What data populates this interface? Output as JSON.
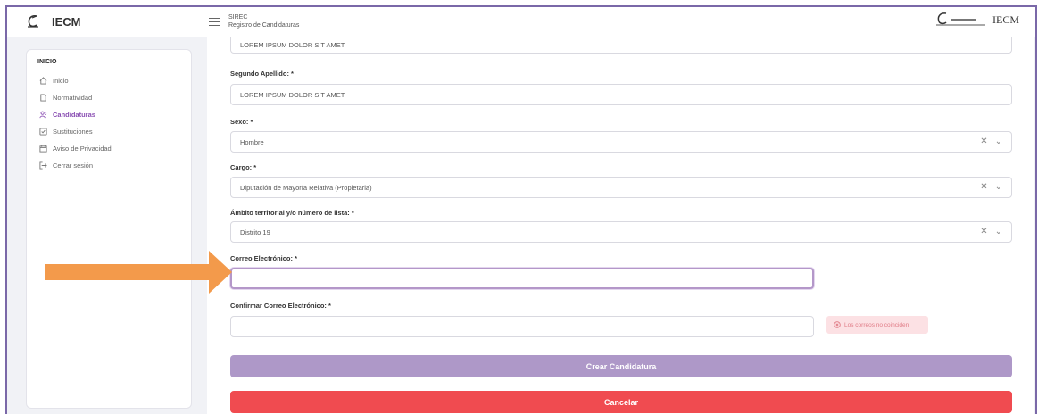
{
  "header": {
    "brand": "IECM",
    "app_name": "SIREC",
    "app_subtitle": "Registro de Candidaturas",
    "right_brand": "IECM"
  },
  "sidebar": {
    "heading": "INICIO",
    "items": [
      {
        "label": "Inicio",
        "icon": "home-icon",
        "active": false
      },
      {
        "label": "Normatividad",
        "icon": "document-icon",
        "active": false
      },
      {
        "label": "Candidaturas",
        "icon": "users-icon",
        "active": true
      },
      {
        "label": "Sustituciones",
        "icon": "check-square-icon",
        "active": false
      },
      {
        "label": "Aviso de Privacidad",
        "icon": "calendar-icon",
        "active": false
      },
      {
        "label": "Cerrar sesión",
        "icon": "logout-icon",
        "active": false
      }
    ]
  },
  "form": {
    "previous_value": "LOREM IPSUM DOLOR SIT AMET",
    "segundo_apellido": {
      "label": "Segundo Apellido: *",
      "value": "LOREM IPSUM DOLOR SIT AMET"
    },
    "sexo": {
      "label": "Sexo: *",
      "value": "Hombre"
    },
    "cargo": {
      "label": "Cargo: *",
      "value": "Diputación de Mayoría Relativa (Propietaria)"
    },
    "ambito": {
      "label": "Ámbito territorial y/o número de lista: *",
      "value": "Distrito 19"
    },
    "correo": {
      "label": "Correo Electrónico: *",
      "value": ""
    },
    "confirmar_correo": {
      "label": "Confirmar Correo Electrónico: *",
      "value": ""
    },
    "error": "Los correos no coinciden",
    "clear_glyph": "✕",
    "chevron_glyph": "⌄"
  },
  "buttons": {
    "create": "Crear Candidatura",
    "cancel": "Cancelar"
  },
  "colors": {
    "accent": "#8a4fb3",
    "primary_button": "#ae98c8",
    "danger_button": "#f04b50",
    "annotation_arrow": "#f39a4b"
  }
}
